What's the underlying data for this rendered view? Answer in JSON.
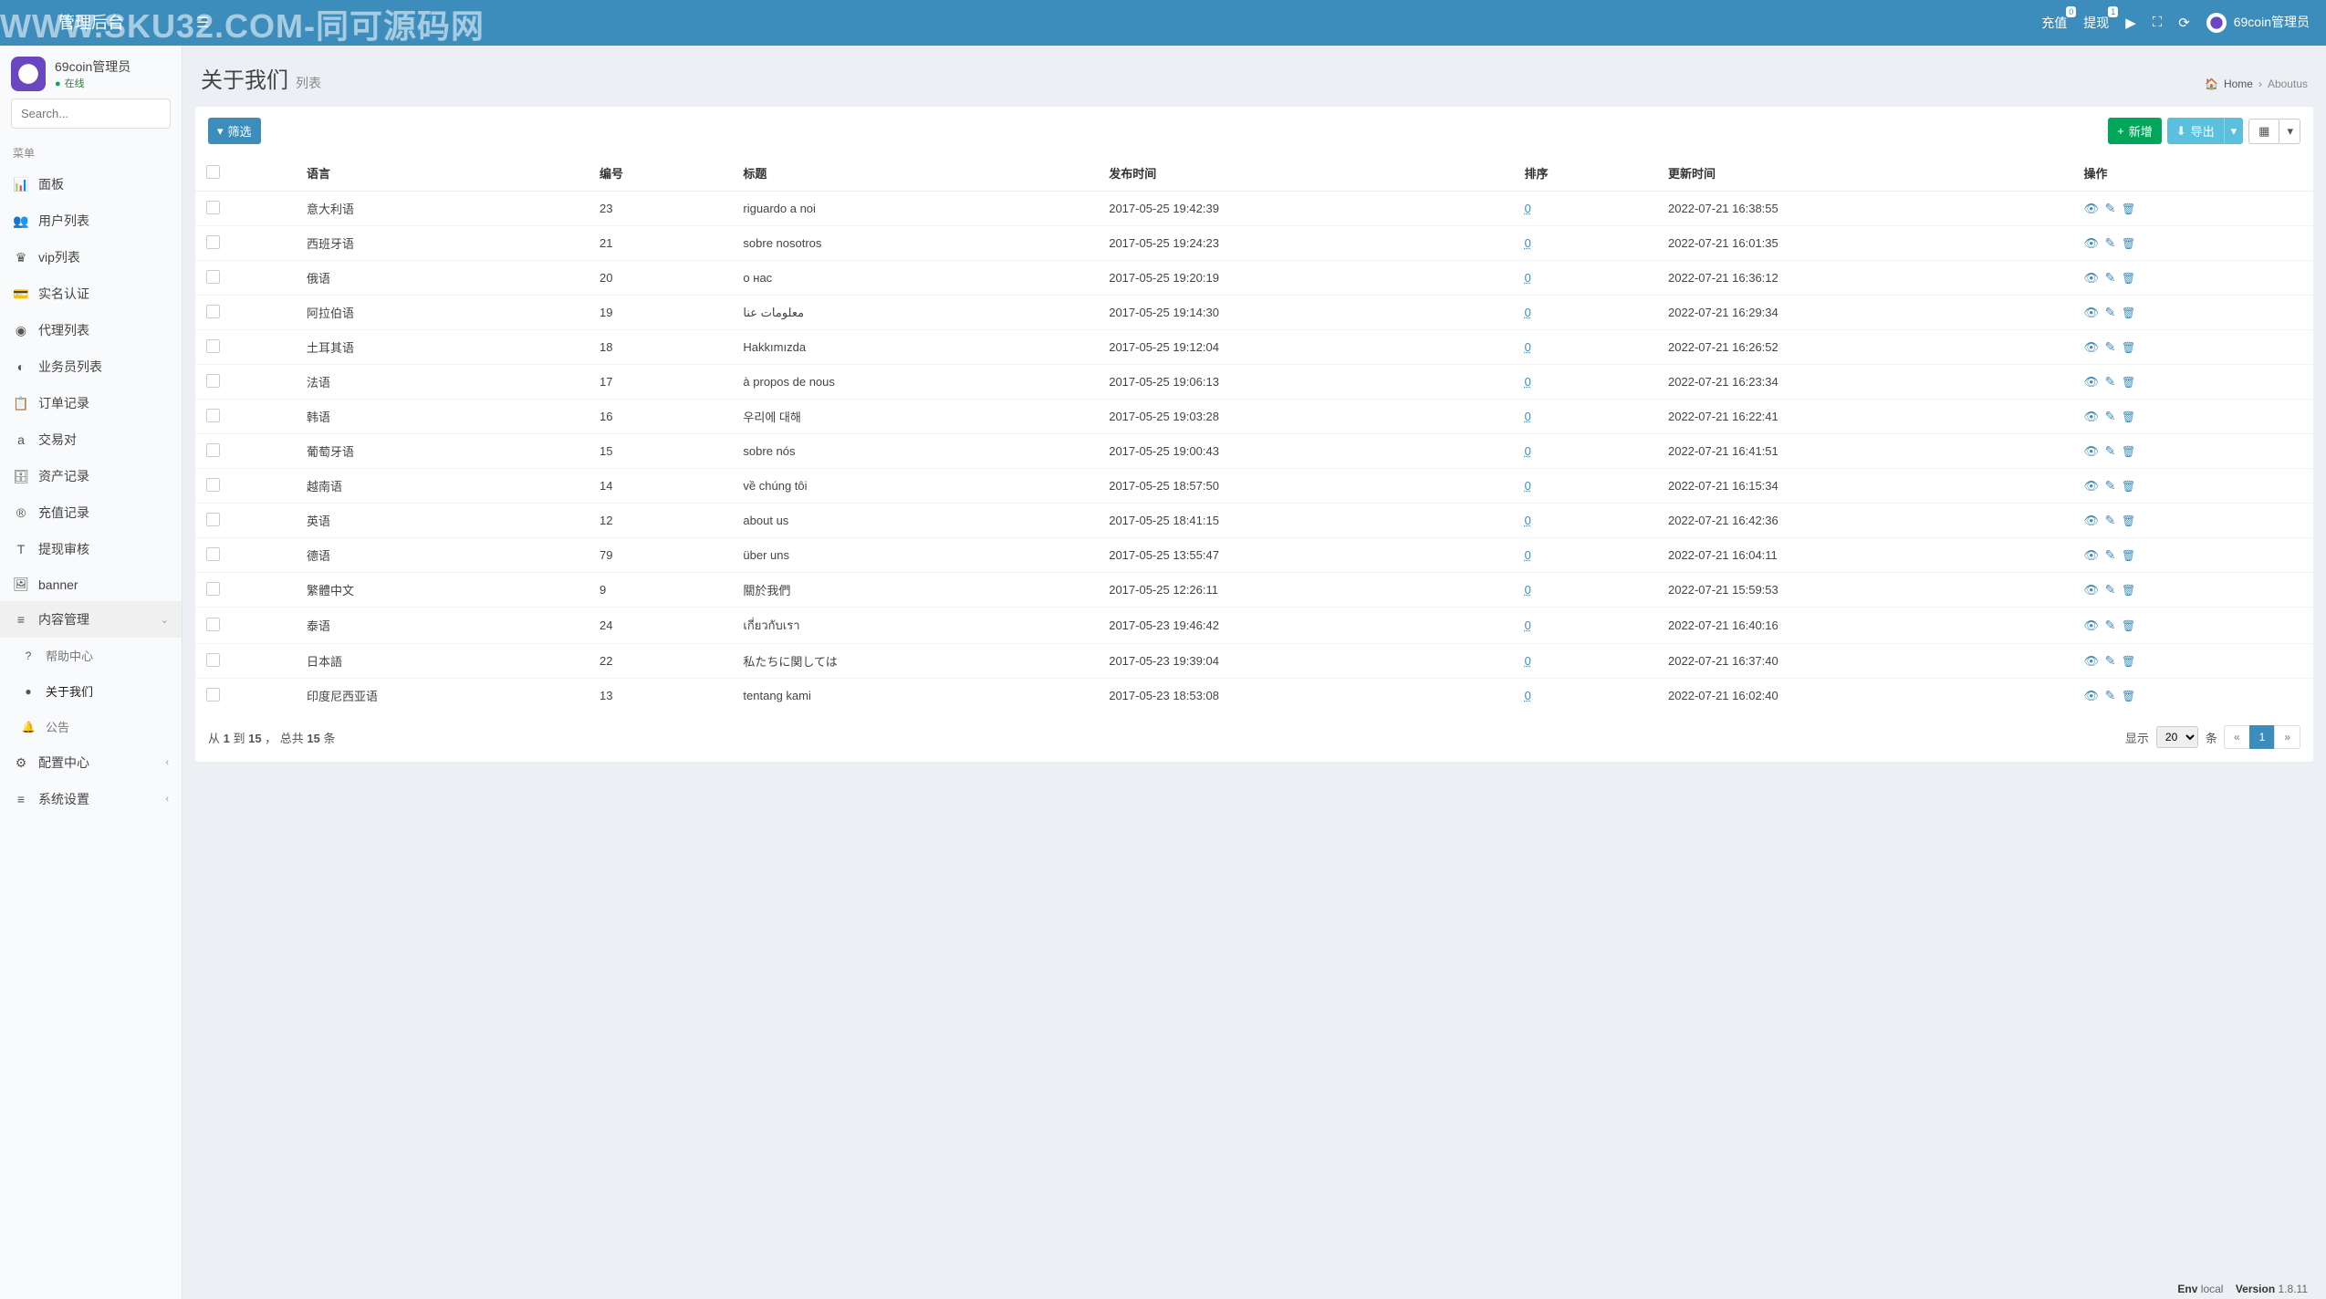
{
  "watermark": "WWW.SKU32.COM-同可源码网",
  "header": {
    "logo": "管理后台",
    "recharge": "充值",
    "recharge_badge": "0",
    "withdraw": "提现",
    "withdraw_badge": "1",
    "admin_name": "69coin管理员"
  },
  "user_panel": {
    "name": "69coin管理员",
    "status": "在线"
  },
  "search": {
    "placeholder": "Search..."
  },
  "menu": {
    "header": "菜单",
    "items": [
      {
        "icon": "📊",
        "label": "面板"
      },
      {
        "icon": "👥",
        "label": "用户列表"
      },
      {
        "icon": "♛",
        "label": "vip列表"
      },
      {
        "icon": "💳",
        "label": "实名认证"
      },
      {
        "icon": "◉",
        "label": "代理列表"
      },
      {
        "icon": "◐",
        "label": "业务员列表"
      },
      {
        "icon": "📋",
        "label": "订单记录"
      },
      {
        "icon": "a",
        "label": "交易对"
      },
      {
        "icon": "🗄",
        "label": "资产记录"
      },
      {
        "icon": "®",
        "label": "充值记录"
      },
      {
        "icon": "T",
        "label": "提现审核"
      },
      {
        "icon": "🖼",
        "label": "banner"
      }
    ],
    "content_mgmt": {
      "icon": "≡",
      "label": "内容管理"
    },
    "content_sub": [
      {
        "icon": "?",
        "label": "帮助中心"
      },
      {
        "icon": "●",
        "label": "关于我们",
        "active": true
      },
      {
        "icon": "🔔",
        "label": "公告"
      }
    ],
    "config_center": {
      "icon": "⚙",
      "label": "配置中心"
    },
    "sys_settings": {
      "icon": "≡",
      "label": "系统设置"
    }
  },
  "page": {
    "title": "关于我们",
    "subtitle": "列表",
    "crumb_home": "Home",
    "crumb_current": "Aboutus"
  },
  "toolbar": {
    "filter": "筛选",
    "add": "新增",
    "export": "导出"
  },
  "columns": {
    "lang": "语言",
    "id": "编号",
    "title": "标题",
    "pub": "发布时间",
    "sort": "排序",
    "upd": "更新时间",
    "ops": "操作"
  },
  "rows": [
    {
      "lang": "意大利语",
      "id": "23",
      "title": "riguardo a noi",
      "pub": "2017-05-25 19:42:39",
      "sort": "0",
      "upd": "2022-07-21 16:38:55"
    },
    {
      "lang": "西班牙语",
      "id": "21",
      "title": "sobre nosotros",
      "pub": "2017-05-25 19:24:23",
      "sort": "0",
      "upd": "2022-07-21 16:01:35"
    },
    {
      "lang": "俄语",
      "id": "20",
      "title": "о нас",
      "pub": "2017-05-25 19:20:19",
      "sort": "0",
      "upd": "2022-07-21 16:36:12"
    },
    {
      "lang": "阿拉伯语",
      "id": "19",
      "title": "معلومات عنا",
      "pub": "2017-05-25 19:14:30",
      "sort": "0",
      "upd": "2022-07-21 16:29:34"
    },
    {
      "lang": "土耳其语",
      "id": "18",
      "title": "Hakkımızda",
      "pub": "2017-05-25 19:12:04",
      "sort": "0",
      "upd": "2022-07-21 16:26:52"
    },
    {
      "lang": "法语",
      "id": "17",
      "title": "à propos de nous",
      "pub": "2017-05-25 19:06:13",
      "sort": "0",
      "upd": "2022-07-21 16:23:34"
    },
    {
      "lang": "韩语",
      "id": "16",
      "title": "우리에 대해",
      "pub": "2017-05-25 19:03:28",
      "sort": "0",
      "upd": "2022-07-21 16:22:41"
    },
    {
      "lang": "葡萄牙语",
      "id": "15",
      "title": "sobre nós",
      "pub": "2017-05-25 19:00:43",
      "sort": "0",
      "upd": "2022-07-21 16:41:51"
    },
    {
      "lang": "越南语",
      "id": "14",
      "title": "về chúng tôi",
      "pub": "2017-05-25 18:57:50",
      "sort": "0",
      "upd": "2022-07-21 16:15:34"
    },
    {
      "lang": "英语",
      "id": "12",
      "title": "about us",
      "pub": "2017-05-25 18:41:15",
      "sort": "0",
      "upd": "2022-07-21 16:42:36"
    },
    {
      "lang": "德语",
      "id": "79",
      "title": "über uns",
      "pub": "2017-05-25 13:55:47",
      "sort": "0",
      "upd": "2022-07-21 16:04:11"
    },
    {
      "lang": "繁體中文",
      "id": "9",
      "title": "關於我們",
      "pub": "2017-05-25 12:26:11",
      "sort": "0",
      "upd": "2022-07-21 15:59:53"
    },
    {
      "lang": "泰语",
      "id": "24",
      "title": "เกี่ยวกับเรา",
      "pub": "2017-05-23 19:46:42",
      "sort": "0",
      "upd": "2022-07-21 16:40:16"
    },
    {
      "lang": "日本語",
      "id": "22",
      "title": "私たちに関しては",
      "pub": "2017-05-23 19:39:04",
      "sort": "0",
      "upd": "2022-07-21 16:37:40"
    },
    {
      "lang": "印度尼西亚语",
      "id": "13",
      "title": "tentang kami",
      "pub": "2017-05-23 18:53:08",
      "sort": "0",
      "upd": "2022-07-21 16:02:40"
    }
  ],
  "footer": {
    "range_prefix": "从 ",
    "from": "1",
    "range_mid": " 到 ",
    "to": "15",
    "range_suffix": " ，  总共 ",
    "total": "15",
    "total_suffix": " 条",
    "show_label": "显示",
    "per_page": "20",
    "items_label": "条",
    "prev": "«",
    "page": "1",
    "next": "»"
  },
  "page_footer": {
    "env_label": "Env",
    "env": "local",
    "ver_label": "Version",
    "ver": "1.8.11"
  }
}
